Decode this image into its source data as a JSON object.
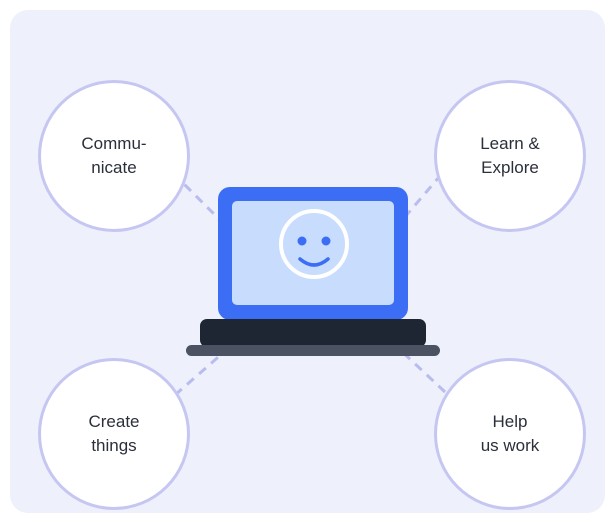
{
  "nodes": {
    "communicate": {
      "label": "Commu-\nnicate"
    },
    "learn_explore": {
      "label": "Learn &\nExplore"
    },
    "create_things": {
      "label": "Create\nthings"
    },
    "help_us_work": {
      "label": "Help\nus work"
    }
  },
  "colors": {
    "panel_background": "#eef0fb",
    "circle_border": "#c5c7f2",
    "connector": "#b9bcee",
    "laptop_frame": "#3b6ef5",
    "laptop_screen": "#c8dcfd",
    "laptop_base": "#1f2633",
    "laptop_stand": "#4b5363"
  },
  "icons": {
    "center": "laptop-icon",
    "screen_face": "smiley-face-icon"
  }
}
